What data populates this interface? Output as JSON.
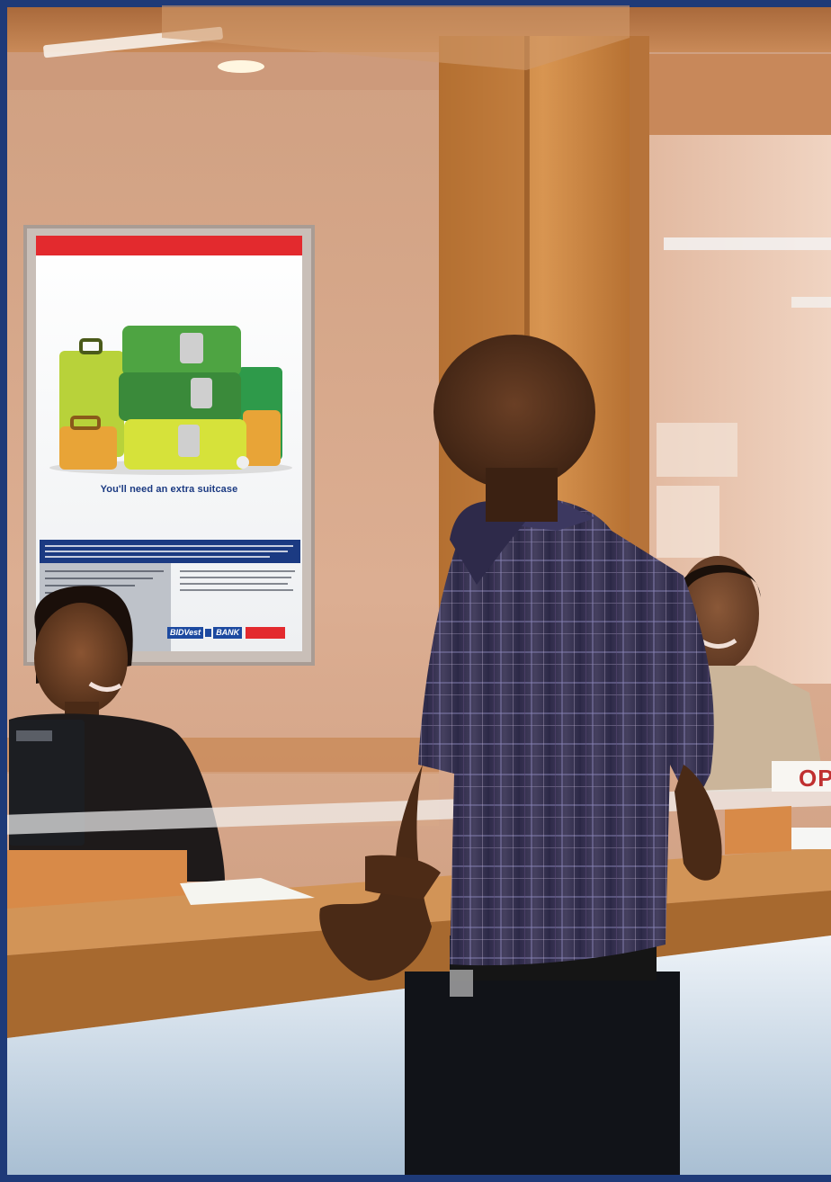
{
  "poster": {
    "headline": "You'll need an extra suitcase",
    "logo_left": "BIDVest",
    "logo_right": "BANK"
  },
  "counter_sign": {
    "text": "OP"
  },
  "colors": {
    "frame_blue": "#1e3a78",
    "wood": "#c98a45",
    "wall": "#d8a88a",
    "shirt": "#3a3558",
    "poster_red": "#e32a2e",
    "poster_navy": "#1b3a82"
  }
}
